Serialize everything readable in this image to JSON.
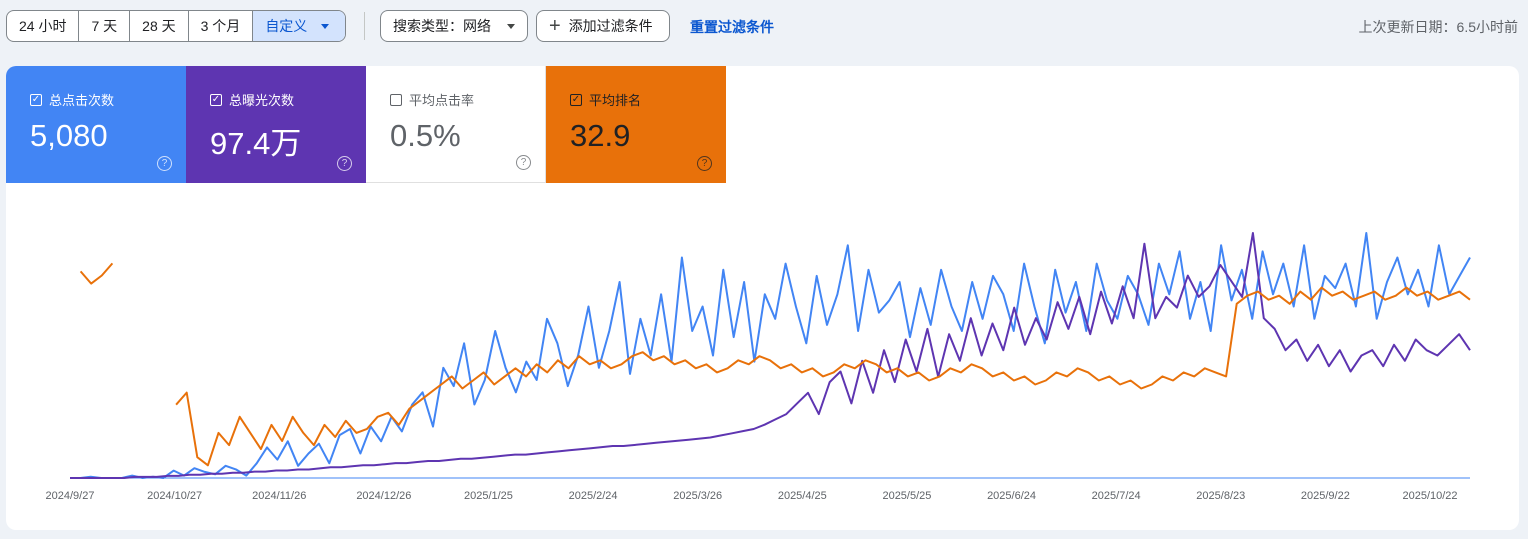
{
  "toolbar": {
    "ranges": [
      "24 小时",
      "7 天",
      "28 天",
      "3 个月",
      "自定义"
    ],
    "active_range": "自定义",
    "search_type": "搜索类型：网络",
    "add_filter": "添加过滤条件",
    "reset": "重置过滤条件",
    "last_updated": "上次更新日期：6.5小时前"
  },
  "metrics": [
    {
      "label": "总点击次数",
      "value": "5,080",
      "checked": true,
      "color": "#4285f4"
    },
    {
      "label": "总曝光次数",
      "value": "97.4万",
      "checked": true,
      "color": "#5e35b1"
    },
    {
      "label": "平均点击率",
      "value": "0.5%",
      "checked": false,
      "color": "#ffffff"
    },
    {
      "label": "平均排名",
      "value": "32.9",
      "checked": true,
      "color": "#e8710a"
    }
  ],
  "chart_data": {
    "type": "line",
    "x_ticks": [
      "2024/9/27",
      "2024/10/27",
      "2024/11/26",
      "2024/12/26",
      "2025/1/25",
      "2025/2/24",
      "2025/3/26",
      "2025/4/25",
      "2025/5/25",
      "2025/6/24",
      "2025/7/24",
      "2025/8/23",
      "2025/9/22",
      "2025/10/22"
    ],
    "grid": false,
    "y_axes_shown": false,
    "series": [
      {
        "name": "总点击次数",
        "color": "#4285f4",
        "values": [
          0,
          0,
          1,
          0,
          0,
          0,
          2,
          0,
          1,
          0,
          6,
          2,
          8,
          5,
          3,
          10,
          7,
          2,
          12,
          25,
          15,
          30,
          10,
          20,
          28,
          12,
          35,
          40,
          20,
          42,
          30,
          50,
          38,
          60,
          70,
          42,
          90,
          75,
          110,
          60,
          80,
          120,
          90,
          70,
          95,
          80,
          130,
          110,
          75,
          100,
          140,
          90,
          120,
          160,
          85,
          130,
          100,
          150,
          95,
          180,
          120,
          140,
          100,
          170,
          115,
          160,
          95,
          150,
          130,
          175,
          140,
          110,
          165,
          125,
          150,
          190,
          120,
          170,
          135,
          145,
          160,
          115,
          155,
          125,
          170,
          140,
          120,
          160,
          130,
          165,
          150,
          120,
          175,
          140,
          110,
          170,
          135,
          160,
          120,
          175,
          145,
          130,
          165,
          150,
          125,
          175,
          150,
          185,
          130,
          160,
          120,
          190,
          145,
          170,
          130,
          185,
          150,
          175,
          140,
          190,
          130,
          165,
          155,
          175,
          140,
          200,
          130,
          160,
          180,
          150,
          170,
          140,
          190,
          150,
          165,
          180
        ]
      },
      {
        "name": "总曝光次数",
        "color": "#5e35b1",
        "values": [
          0,
          0,
          0,
          0,
          0,
          0,
          1,
          1,
          1,
          2,
          2,
          3,
          3,
          4,
          4,
          5,
          5,
          6,
          6,
          7,
          7,
          8,
          8,
          9,
          10,
          10,
          11,
          12,
          12,
          13,
          14,
          14,
          15,
          16,
          16,
          17,
          18,
          18,
          19,
          20,
          21,
          22,
          22,
          23,
          24,
          25,
          26,
          27,
          28,
          29,
          30,
          30,
          31,
          32,
          33,
          34,
          35,
          36,
          37,
          38,
          40,
          42,
          44,
          46,
          50,
          55,
          60,
          70,
          80,
          60,
          90,
          100,
          70,
          110,
          80,
          120,
          90,
          130,
          100,
          140,
          95,
          135,
          110,
          150,
          115,
          145,
          120,
          160,
          125,
          150,
          130,
          165,
          140,
          170,
          135,
          175,
          145,
          180,
          150,
          220,
          150,
          170,
          160,
          190,
          170,
          180,
          200,
          185,
          170,
          230,
          150,
          140,
          120,
          130,
          110,
          125,
          105,
          120,
          100,
          115,
          120,
          105,
          125,
          110,
          130,
          120,
          115,
          125,
          135,
          120
        ]
      },
      {
        "name": "平均排名",
        "color": "#e8710a",
        "values": [
          null,
          12,
          15,
          13,
          10,
          null,
          null,
          null,
          null,
          null,
          45,
          42,
          58,
          60,
          52,
          55,
          48,
          52,
          56,
          50,
          54,
          48,
          52,
          55,
          50,
          53,
          49,
          52,
          51,
          48,
          47,
          50,
          46,
          44,
          42,
          40,
          38,
          41,
          39,
          37,
          40,
          38,
          36,
          38,
          35,
          37,
          34,
          36,
          33,
          35,
          34,
          36,
          35,
          33,
          32,
          34,
          33,
          35,
          34,
          36,
          35,
          37,
          36,
          34,
          35,
          33,
          34,
          36,
          35,
          37,
          36,
          38,
          37,
          35,
          36,
          34,
          35,
          37,
          36,
          38,
          37,
          39,
          38,
          36,
          37,
          35,
          36,
          38,
          37,
          39,
          38,
          40,
          39,
          37,
          38,
          36,
          37,
          39,
          38,
          40,
          39,
          41,
          40,
          38,
          39,
          37,
          38,
          36,
          37,
          38,
          20,
          18,
          17,
          19,
          18,
          20,
          17,
          19,
          16,
          18,
          17,
          19,
          18,
          17,
          19,
          18,
          16,
          18,
          17,
          19,
          18,
          17,
          19
        ]
      }
    ]
  }
}
